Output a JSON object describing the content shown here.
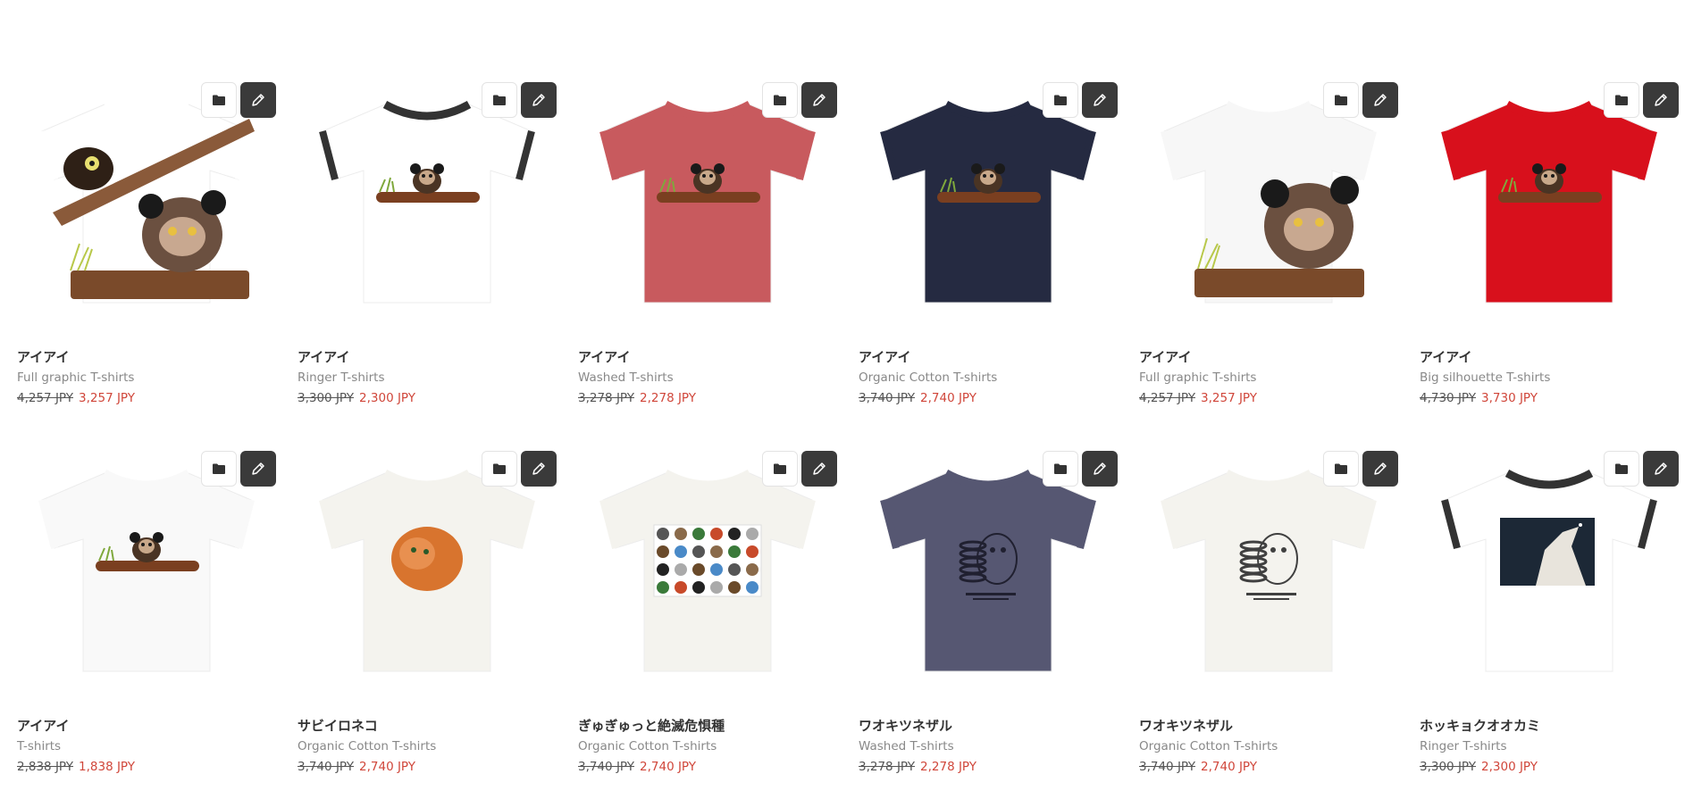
{
  "products": [
    {
      "title": "アイアイ",
      "type": "Full graphic T-shirts",
      "original_price": "4,257 JPY",
      "sale_price": "3,257 JPY",
      "shirt_color": "#ffffff",
      "trim_color": "#ffffff",
      "art": "aye-aye-full-graphic"
    },
    {
      "title": "アイアイ",
      "type": "Ringer T-shirts",
      "original_price": "3,300 JPY",
      "sale_price": "2,300 JPY",
      "shirt_color": "#ffffff",
      "trim_color": "#333333",
      "art": "aye-aye-on-branch"
    },
    {
      "title": "アイアイ",
      "type": "Washed T-shirts",
      "original_price": "3,278 JPY",
      "sale_price": "2,278 JPY",
      "shirt_color": "#c85a5e",
      "trim_color": "#c85a5e",
      "art": "aye-aye-on-branch"
    },
    {
      "title": "アイアイ",
      "type": "Organic Cotton T-shirts",
      "original_price": "3,740 JPY",
      "sale_price": "2,740 JPY",
      "shirt_color": "#252a41",
      "trim_color": "#252a41",
      "art": "aye-aye-on-branch"
    },
    {
      "title": "アイアイ",
      "type": "Full graphic T-shirts",
      "original_price": "4,257 JPY",
      "sale_price": "3,257 JPY",
      "shirt_color": "#f7f7f7",
      "trim_color": "#f7f7f7",
      "art": "aye-aye-closeup"
    },
    {
      "title": "アイアイ",
      "type": "Big silhouette T-shirts",
      "original_price": "4,730 JPY",
      "sale_price": "3,730 JPY",
      "shirt_color": "#d8101c",
      "trim_color": "#d8101c",
      "art": "aye-aye-on-branch"
    },
    {
      "title": "アイアイ",
      "type": "T-shirts",
      "original_price": "2,838 JPY",
      "sale_price": "1,838 JPY",
      "shirt_color": "#f9f9f9",
      "trim_color": "#f9f9f9",
      "art": "aye-aye-on-branch"
    },
    {
      "title": "サビイロネコ",
      "type": "Organic Cotton T-shirts",
      "original_price": "3,740 JPY",
      "sale_price": "2,740 JPY",
      "shirt_color": "#f4f3ee",
      "trim_color": "#f4f3ee",
      "art": "rusty-spotted-cat"
    },
    {
      "title": "ぎゅぎゅっと絶滅危惧種",
      "type": "Organic Cotton T-shirts",
      "original_price": "3,740 JPY",
      "sale_price": "2,740 JPY",
      "shirt_color": "#f4f3ee",
      "trim_color": "#f4f3ee",
      "art": "endangered-species-collage"
    },
    {
      "title": "ワオキツネザル",
      "type": "Washed T-shirts",
      "original_price": "3,278 JPY",
      "sale_price": "2,278 JPY",
      "shirt_color": "#565772",
      "trim_color": "#565772",
      "art": "ring-tailed-lemur"
    },
    {
      "title": "ワオキツネザル",
      "type": "Organic Cotton T-shirts",
      "original_price": "3,740 JPY",
      "sale_price": "2,740 JPY",
      "shirt_color": "#f4f3ee",
      "trim_color": "#f4f3ee",
      "art": "ring-tailed-lemur"
    },
    {
      "title": "ホッキョクオオカミ",
      "type": "Ringer T-shirts",
      "original_price": "3,300 JPY",
      "sale_price": "2,300 JPY",
      "shirt_color": "#ffffff",
      "trim_color": "#333333",
      "art": "arctic-wolf-howling"
    }
  ],
  "icons": {
    "folder": "folder-icon",
    "edit": "pencil-icon"
  }
}
